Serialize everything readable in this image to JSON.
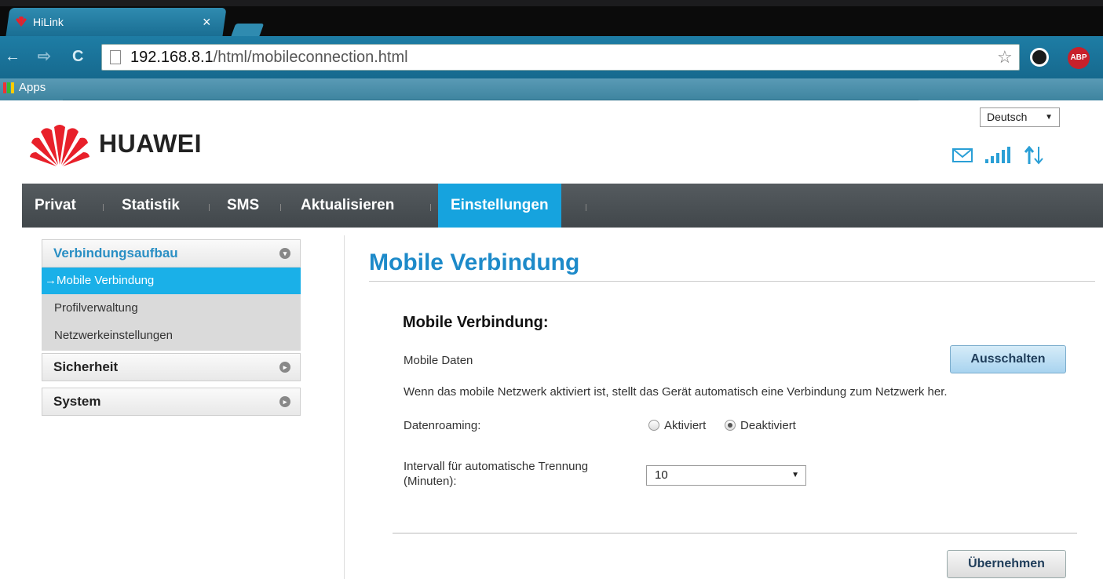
{
  "browser": {
    "tab_title": "HiLink",
    "tab_close": "×",
    "url_host": "192.168.8.1",
    "url_path": "/html/mobileconnection.html",
    "bookmarks_apps": "Apps",
    "ext_abp": "ABP"
  },
  "header": {
    "brand": "HUAWEI",
    "language": "Deutsch"
  },
  "menu": {
    "items": [
      "Privat",
      "Statistik",
      "SMS",
      "Aktualisieren",
      "Einstellungen"
    ],
    "active": "Einstellungen"
  },
  "sidebar": {
    "section1": "Verbindungsaufbau",
    "sub_active": "→Mobile Verbindung",
    "sub2": "Profilverwaltung",
    "sub3": "Netzwerkeinstellungen",
    "section2": "Sicherheit",
    "section3": "System"
  },
  "main": {
    "title": "Mobile Verbindung",
    "section_title": "Mobile Verbindung:",
    "mobile_data_label": "Mobile Daten",
    "mobile_data_button": "Ausschalten",
    "info_text": "Wenn das mobile Netzwerk aktiviert ist, stellt das Gerät automatisch eine Verbindung zum Netzwerk her.",
    "roaming_label": "Datenroaming:",
    "roaming_on": "Aktiviert",
    "roaming_off": "Deaktiviert",
    "roaming_selected": "Deaktiviert",
    "interval_label_1": "Intervall für automatische Trennung",
    "interval_label_2": "(Minuten):",
    "interval_value": "10",
    "apply_button": "Übernehmen"
  },
  "colors": {
    "accent": "#16a3de",
    "title_blue": "#1d8ac9"
  }
}
